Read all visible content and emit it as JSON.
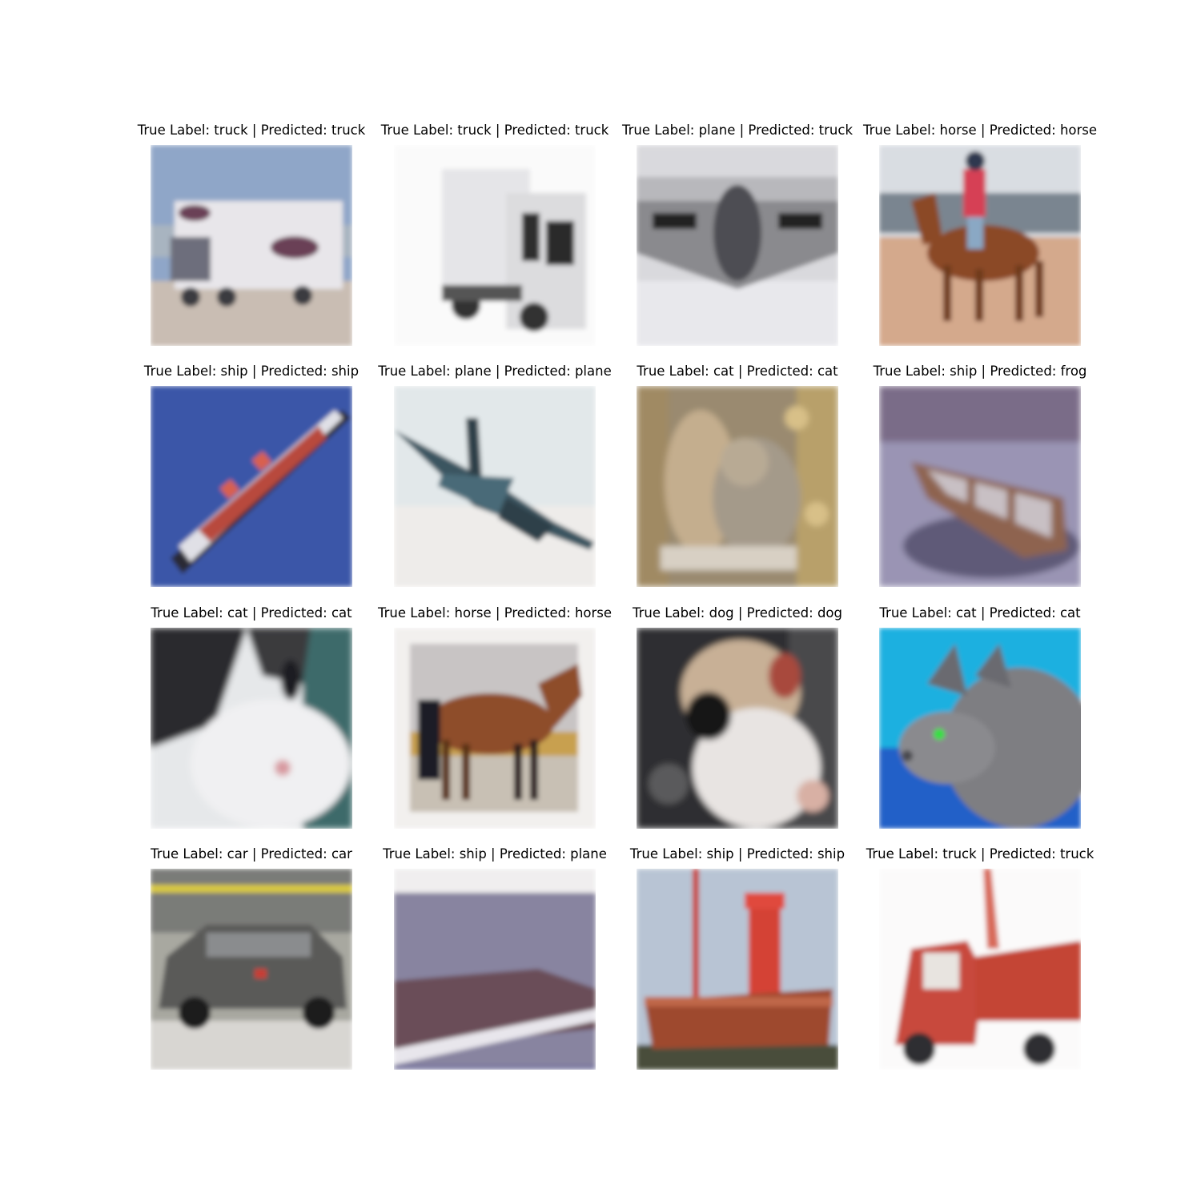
{
  "figure": {
    "panels": [
      {
        "title": "True Label: truck | Predicted: truck",
        "true_label": "truck",
        "predicted": "truck",
        "scene": "truck-van"
      },
      {
        "title": "True Label: truck | Predicted: truck",
        "true_label": "truck",
        "predicted": "truck",
        "scene": "truck-white"
      },
      {
        "title": "True Label: plane | Predicted: truck",
        "true_label": "plane",
        "predicted": "truck",
        "scene": "plane-stealth"
      },
      {
        "title": "True Label: horse | Predicted: horse",
        "true_label": "horse",
        "predicted": "horse",
        "scene": "horse-rider"
      },
      {
        "title": "True Label: ship | Predicted: ship",
        "true_label": "ship",
        "predicted": "ship",
        "scene": "ship-container"
      },
      {
        "title": "True Label: plane | Predicted: plane",
        "true_label": "plane",
        "predicted": "plane",
        "scene": "plane-jet"
      },
      {
        "title": "True Label: cat | Predicted: cat",
        "true_label": "cat",
        "predicted": "cat",
        "scene": "cat-tabby"
      },
      {
        "title": "True Label: ship | Predicted: frog",
        "true_label": "ship",
        "predicted": "frog",
        "scene": "boat-purple"
      },
      {
        "title": "True Label: cat | Predicted: cat",
        "true_label": "cat",
        "predicted": "cat",
        "scene": "cat-closeup"
      },
      {
        "title": "True Label: horse | Predicted: horse",
        "true_label": "horse",
        "predicted": "horse",
        "scene": "horse-brown"
      },
      {
        "title": "True Label: dog | Predicted: dog",
        "true_label": "dog",
        "predicted": "dog",
        "scene": "dog-closeup"
      },
      {
        "title": "True Label: cat | Predicted: cat",
        "true_label": "cat",
        "predicted": "cat",
        "scene": "cat-blue"
      },
      {
        "title": "True Label: car | Predicted: car",
        "true_label": "car",
        "predicted": "car",
        "scene": "car-grey"
      },
      {
        "title": "True Label: ship | Predicted: plane",
        "true_label": "ship",
        "predicted": "plane",
        "scene": "ship-distant"
      },
      {
        "title": "True Label: ship | Predicted: ship",
        "true_label": "ship",
        "predicted": "ship",
        "scene": "ship-lighthouse"
      },
      {
        "title": "True Label: truck | Predicted: truck",
        "true_label": "truck",
        "predicted": "truck",
        "scene": "truck-red"
      }
    ]
  }
}
